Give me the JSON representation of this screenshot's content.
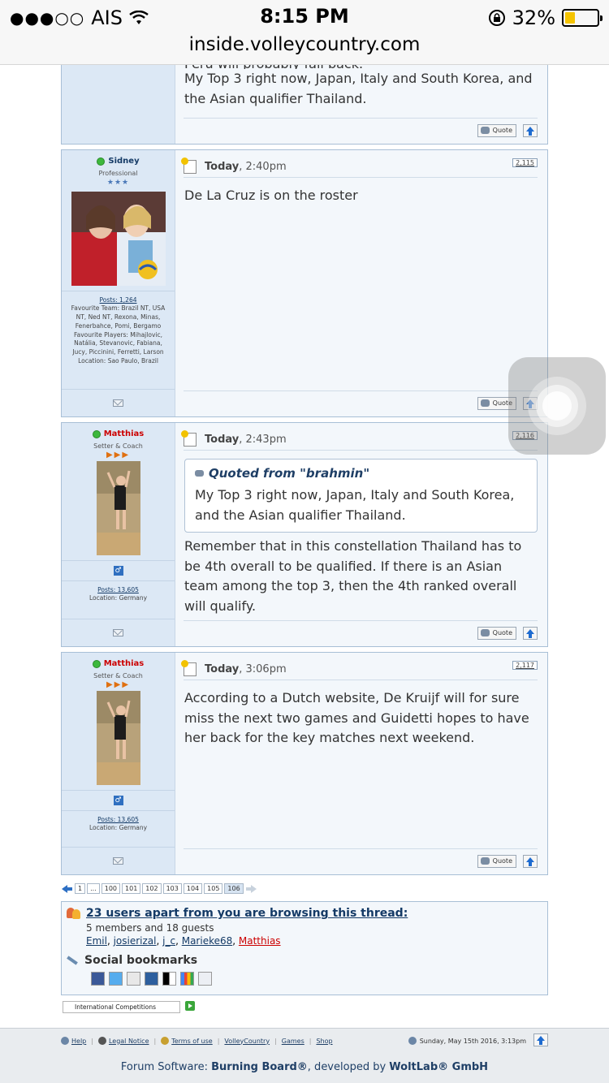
{
  "status": {
    "carrier": "AIS",
    "time": "8:15 PM",
    "battery": "32%",
    "battery_level": 0.32,
    "url": "inside.volleycountry.com"
  },
  "partial_post": {
    "text_cut": "Peru will probably fall back.",
    "text": "My Top 3 right now, Japan, Italy and South Korea, and the Asian qualifier Thailand.",
    "quote_label": "Quote"
  },
  "posts": [
    {
      "username": "Sidney",
      "rank": "Professional",
      "posts": "Posts: 1,264",
      "fav_team": "Favourite Team: Brazil NT, USA NT, Ned NT, Rexona, Minas, Fenerbahce, Pomi, Bergamo",
      "fav_players": "Favourite Players: Mihajlovic, Natália, Stevanovic, Fabiana, Jucy, Piccinini, Ferretti, Larson",
      "location": "Location: Sao Paulo, Brazil",
      "date_bold": "Today",
      "date_rest": ", 2:40pm",
      "number": "2,115",
      "text": "De La Cruz is on the roster",
      "quote_label": "Quote"
    },
    {
      "username": "Matthias",
      "rank": "Setter & Coach",
      "posts": "Posts: 13,605",
      "location": "Location: Germany",
      "date_bold": "Today",
      "date_rest": ", 2:43pm",
      "number": "2,116",
      "quote_title": "Quoted from \"brahmin\"",
      "quote_text": "My Top 3 right now, Japan, Italy and South Korea, and the Asian qualifier Thailand.",
      "text": "Remember that in this constellation Thailand has to be 4th overall to be qualified. If there is an Asian team among the top 3, then the 4th ranked overall will qualify.",
      "quote_label": "Quote"
    },
    {
      "username": "Matthias",
      "rank": "Setter & Coach",
      "posts": "Posts: 13,605",
      "location": "Location: Germany",
      "date_bold": "Today",
      "date_rest": ", 3:06pm",
      "number": "2,117",
      "text": "According to a Dutch website, De Kruijf will for sure miss the next two games and Guidetti hopes to have her back for the key matches next weekend.",
      "quote_label": "Quote"
    }
  ],
  "pagination": [
    "1",
    "...",
    "100",
    "101",
    "102",
    "103",
    "104",
    "105",
    "106"
  ],
  "browsing": {
    "title": "23 users apart from you are browsing this thread:",
    "sub": "5 members and 18 guests",
    "users": [
      "Emil",
      "josierizal",
      "j_c",
      "Marieke68",
      "Matthias"
    ],
    "social_title": "Social bookmarks"
  },
  "jump": "International Competitions",
  "footer": {
    "links": [
      "Help",
      "Legal Notice",
      "Terms of use",
      "VolleyCountry",
      "Games",
      "Shop"
    ],
    "date": "Sunday, May 15th 2016, 3:13pm",
    "credit_prefix": "Forum Software: ",
    "credit_product": "Burning Board®",
    "credit_mid": ", developed by ",
    "credit_company": "WoltLab® GmbH"
  }
}
